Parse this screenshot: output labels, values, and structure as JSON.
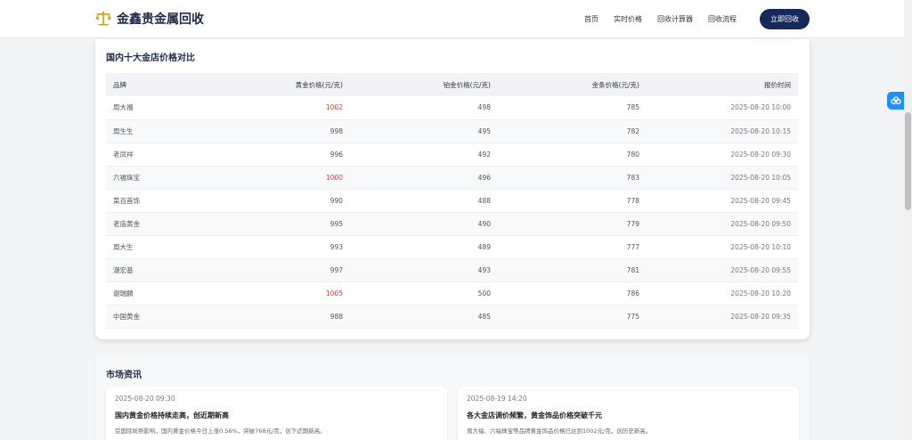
{
  "brand": {
    "name": "金鑫贵金属回收",
    "logo_icon": "scale-icon",
    "accent": "#16295a"
  },
  "nav": {
    "items": [
      "首页",
      "实时价格",
      "回收计算器",
      "回收流程"
    ],
    "cta": "立即回收"
  },
  "price_table": {
    "title": "国内十大金店价格对比",
    "headers": [
      "品牌",
      "黄金价格(元/克)",
      "铂金价格(元/克)",
      "金条价格(元/克)",
      "报价时间"
    ],
    "rows": [
      {
        "brand": "周大福",
        "gold": "1002",
        "platinum": "498",
        "bar": "785",
        "time": "2025-08-20 10:00",
        "highlight": true
      },
      {
        "brand": "周生生",
        "gold": "998",
        "platinum": "495",
        "bar": "782",
        "time": "2025-08-20 10:15",
        "highlight": false
      },
      {
        "brand": "老凤祥",
        "gold": "996",
        "platinum": "492",
        "bar": "780",
        "time": "2025-08-20 09:30",
        "highlight": false
      },
      {
        "brand": "六福珠宝",
        "gold": "1000",
        "platinum": "496",
        "bar": "783",
        "time": "2025-08-20 10:05",
        "highlight": true
      },
      {
        "brand": "菜百首饰",
        "gold": "990",
        "platinum": "488",
        "bar": "778",
        "time": "2025-08-20 09:45",
        "highlight": false
      },
      {
        "brand": "老庙黄金",
        "gold": "995",
        "platinum": "490",
        "bar": "779",
        "time": "2025-08-20 09:50",
        "highlight": false
      },
      {
        "brand": "周大生",
        "gold": "993",
        "platinum": "489",
        "bar": "777",
        "time": "2025-08-20 10:10",
        "highlight": false
      },
      {
        "brand": "潮宏基",
        "gold": "997",
        "platinum": "493",
        "bar": "781",
        "time": "2025-08-20 09:55",
        "highlight": false
      },
      {
        "brand": "谢瑞麟",
        "gold": "1005",
        "platinum": "500",
        "bar": "786",
        "time": "2025-08-20 10:20",
        "highlight": true
      },
      {
        "brand": "中国黄金",
        "gold": "988",
        "platinum": "485",
        "bar": "775",
        "time": "2025-08-20 09:35",
        "highlight": false
      }
    ],
    "highlight_color": "#e53e3e"
  },
  "market_news": {
    "title": "市场资讯",
    "items": [
      {
        "date": "2025-08-20 09:30",
        "title": "国内黄金价格持续走高，创近期新高",
        "desc": "受国际局势影响，国内黄金价格今日上涨0.56%，突破768元/克，创下近期新高。"
      },
      {
        "date": "2025-08-19 14:20",
        "title": "各大金店调价频繁，黄金饰品价格突破千元",
        "desc": "周大福、六福珠宝等品牌黄金饰品价格已达到1002元/克，创历史新高。"
      }
    ]
  }
}
